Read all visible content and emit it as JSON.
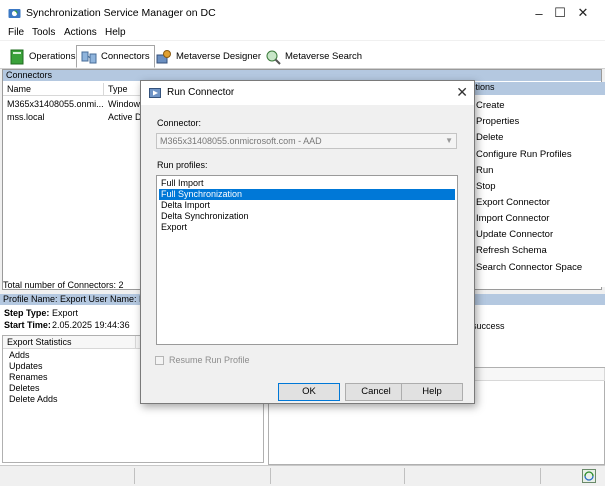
{
  "window": {
    "title": "Synchronization Service Manager on DC"
  },
  "menu": [
    "File",
    "Tools",
    "Actions",
    "Help"
  ],
  "toolbar": {
    "operations": "Operations",
    "connectors": "Connectors",
    "metaverse_designer": "Metaverse Designer",
    "metaverse_search": "Metaverse Search"
  },
  "connectors_pane": {
    "header": "Connectors",
    "columns": [
      "Name",
      "Type"
    ],
    "rows": [
      {
        "name": "M365x31408055.onmi...",
        "type": "Windows"
      },
      {
        "name": "mss.local",
        "type": "Active Di"
      }
    ],
    "total": "Total number of Connectors: 2"
  },
  "actions_pane": {
    "header": "ctions",
    "items": [
      "Create",
      "Properties",
      "Delete",
      "Configure Run Profiles",
      "Run",
      "Stop",
      "Export Connector",
      "Import Connector",
      "Update Connector",
      "Refresh Schema",
      "Search Connector Space"
    ]
  },
  "details": {
    "header": "Profile Name: Export  User Name: MSS",
    "step_type_label": "Step Type:",
    "step_type_value": "Export",
    "start_time_label": "Start Time:",
    "start_time_value": "2.05.2025 19:44:36",
    "status_fragment": "success",
    "export_stats_header": "Export Statistics",
    "export_stats": [
      "Adds",
      "Updates",
      "Renames",
      "Deletes",
      "Delete Adds"
    ]
  },
  "dialog": {
    "title": "Run Connector",
    "connector_label": "Connector:",
    "connector_value": "M365x31408055.onmicrosoft.com - AAD",
    "run_profiles_label": "Run profiles:",
    "run_profiles": [
      "Full Import",
      "Full Synchronization",
      "Delta Import",
      "Delta Synchronization",
      "Export"
    ],
    "selected_index": 1,
    "resume_label": "Resume Run Profile",
    "ok": "OK",
    "cancel": "Cancel",
    "help": "Help"
  },
  "colors": {
    "pane_header": "#b4c8e0",
    "selection": "#0078d7"
  }
}
